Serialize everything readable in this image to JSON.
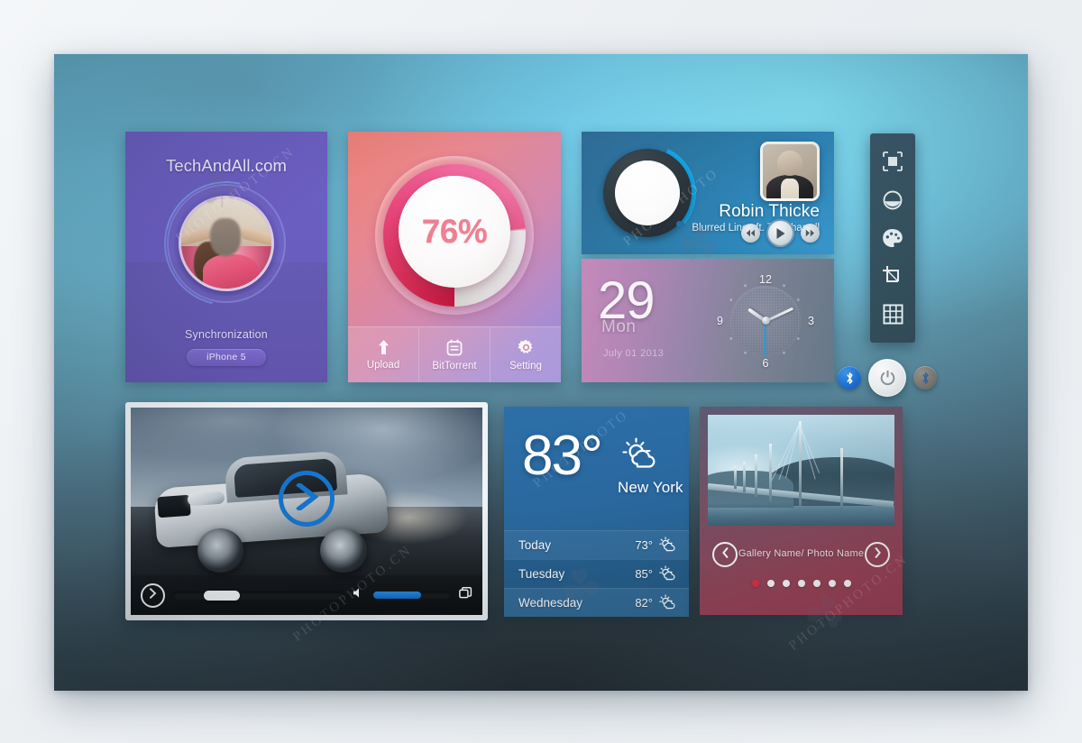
{
  "sync": {
    "brand": "TechAndAll.com",
    "label": "Synchronization",
    "device": "iPhone 5"
  },
  "progress": {
    "value": "76%",
    "percent": 76,
    "actions": [
      {
        "label": "Upload",
        "icon": "upload-icon"
      },
      {
        "label": "BitTorrent",
        "icon": "bittorrent-icon"
      },
      {
        "label": "Setting",
        "icon": "gear-icon"
      }
    ]
  },
  "music": {
    "artist": "Robin Thicke",
    "track": "Blurred Lines ft. T.I, Pharrell",
    "controls": [
      {
        "name": "previous-button",
        "label": "Previous"
      },
      {
        "name": "play-button",
        "label": "Play"
      },
      {
        "name": "next-button",
        "label": "Next"
      }
    ]
  },
  "clock": {
    "date_number": "29",
    "day_name": "Mon",
    "date_sub": "July 01 2013",
    "numerals": {
      "n12": "12",
      "n3": "3",
      "n6": "6",
      "n9": "9"
    },
    "hour_deg": 305,
    "minute_deg": 65,
    "second_deg": 180
  },
  "toolbar": {
    "items": [
      {
        "name": "transform-icon",
        "label": "Transform"
      },
      {
        "name": "contrast-icon",
        "label": "Contrast"
      },
      {
        "name": "palette-icon",
        "label": "Palette"
      },
      {
        "name": "crop-icon",
        "label": "Crop"
      },
      {
        "name": "grid-icon",
        "label": "Grid"
      }
    ]
  },
  "power": {
    "bluetooth_on": "Bluetooth on",
    "power": "Power",
    "bluetooth_off": "Bluetooth off"
  },
  "video": {
    "play_label": "Play",
    "next_label": "Next",
    "seek_percent": 30,
    "volume_percent": 62,
    "fullscreen_label": "Fullscreen"
  },
  "weather": {
    "temperature": "83°",
    "city": "New York",
    "forecast": [
      {
        "day": "Today",
        "high": "73°",
        "icon": "partly-cloudy-icon"
      },
      {
        "day": "Tuesday",
        "high": "85°",
        "icon": "partly-cloudy-icon"
      },
      {
        "day": "Wednesday",
        "high": "82°",
        "icon": "partly-cloudy-icon"
      }
    ]
  },
  "gallery": {
    "caption": "Gallery Name/ Photo Name",
    "prev_label": "Previous photo",
    "next_label": "Next photo",
    "dots_total": 7,
    "dots_active": 1
  },
  "watermarks": {
    "a": "PHOTOPHOTO.CN",
    "b": "PHOTOPHOTO",
    "c": "PHOTOPHOTO.CN",
    "d": "PHOTOPHOTO.CN",
    "e": "PHOTOPHOTO"
  },
  "colors": {
    "accent_blue": "#1578d2",
    "accent_pink": "#ef7f92",
    "accent_red": "#c0173f",
    "weather_blue": "#2d6fa8",
    "sync_purple": "#6d5fc4"
  }
}
